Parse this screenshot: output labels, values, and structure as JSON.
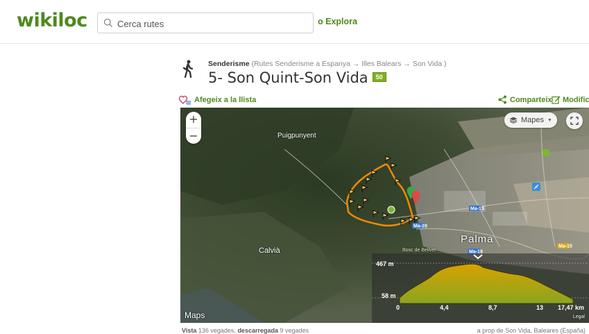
{
  "header": {
    "logo_text": "wikiloc",
    "search_placeholder": "Cerca rutes",
    "explore_label": "o Explora"
  },
  "trail": {
    "activity": "Senderisme",
    "breadcrumb": "(Rutes Senderisme a Espanya → Illes Balears → Son Vida )",
    "title": "5- Son Quint-Son Vida",
    "badge": "50"
  },
  "actions": {
    "add_to_list": "Afegeix a la llista",
    "share": "Comparteix",
    "modify": "Modifica"
  },
  "map": {
    "layers_label": "Mapes",
    "zoom_in": "+",
    "zoom_out": "−",
    "places": {
      "puigpunyent": "Puigpunyent",
      "calvia": "Calvià",
      "palma": "Palma",
      "bosc": "Bosc de Bellver"
    },
    "road_labels": [
      "Ma-13",
      "Ma-20",
      "Ma-19",
      "Ma-15"
    ],
    "attribution": "Maps",
    "legal": "Legal"
  },
  "elevation_profile": {
    "max_label": "467 m",
    "min_label": "58 m",
    "distance_ticks": [
      "0",
      "4,4",
      "8,7",
      "13",
      "17,47 km"
    ],
    "max_elevation_m": 467,
    "min_elevation_m": 58,
    "total_km": 17.47,
    "fill_color": "#d7a200",
    "low_color": "#8aa520"
  },
  "stats": {
    "views_label": "Vista",
    "views_value": "136 vegades,",
    "downloads_label": "descarregada",
    "downloads_value": "9 vegades",
    "near": "a prop de Son Vida, Baleares (España)"
  },
  "colors": {
    "brand": "#4e8a1d",
    "track": "#f08a00"
  }
}
